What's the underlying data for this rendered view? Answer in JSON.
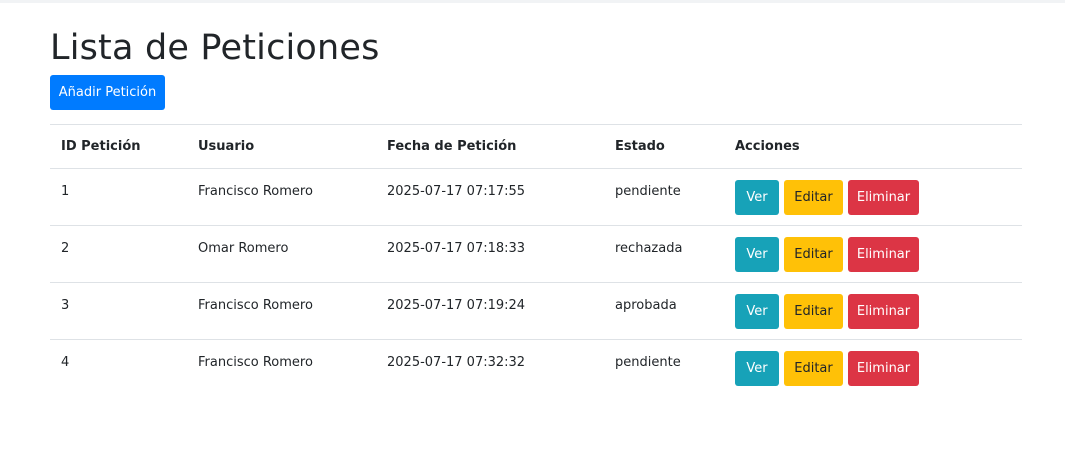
{
  "page": {
    "title": "Lista de Peticiones",
    "add_button_label": "Añadir Petición"
  },
  "table": {
    "headers": {
      "id": "ID Petición",
      "user": "Usuario",
      "date": "Fecha de Petición",
      "status": "Estado",
      "actions": "Acciones"
    },
    "action_labels": {
      "view": "Ver",
      "edit": "Editar",
      "delete": "Eliminar"
    },
    "rows": [
      {
        "id": "1",
        "user": "Francisco Romero",
        "date": "2025-07-17 07:17:55",
        "status": "pendiente"
      },
      {
        "id": "2",
        "user": "Omar Romero",
        "date": "2025-07-17 07:18:33",
        "status": "rechazada"
      },
      {
        "id": "3",
        "user": "Francisco Romero",
        "date": "2025-07-17 07:19:24",
        "status": "aprobada"
      },
      {
        "id": "4",
        "user": "Francisco Romero",
        "date": "2025-07-17 07:32:32",
        "status": "pendiente"
      }
    ]
  },
  "colors": {
    "primary": "#007bff",
    "info": "#17a2b8",
    "warning": "#ffc107",
    "danger": "#dc3545"
  }
}
